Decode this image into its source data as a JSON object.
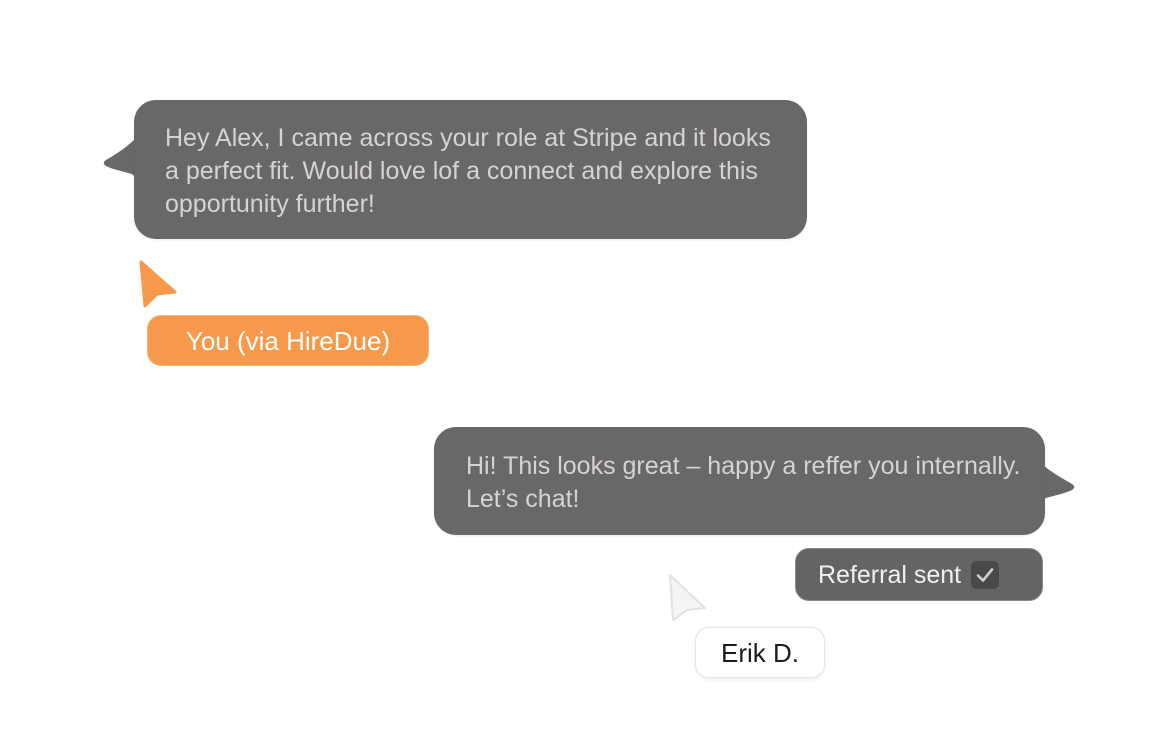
{
  "messages": [
    {
      "text": "Hey Alex, I came across your role at Stripe and it looks a perfect fit. Would love lof a connect and explore this opportunity further!",
      "sender": "You (via HireDue)"
    },
    {
      "text": "Hi! This looks great – happy a reffer you internally. Let’s chat!",
      "sender": "Erik D."
    }
  ],
  "badge": {
    "label": "Referral sent",
    "icon": "checkmark-icon"
  },
  "colors": {
    "bubble": "#6a6867",
    "bubble_text": "#d6d4d2",
    "accent_orange": "#f6994a",
    "badge_bg": "#656463"
  }
}
